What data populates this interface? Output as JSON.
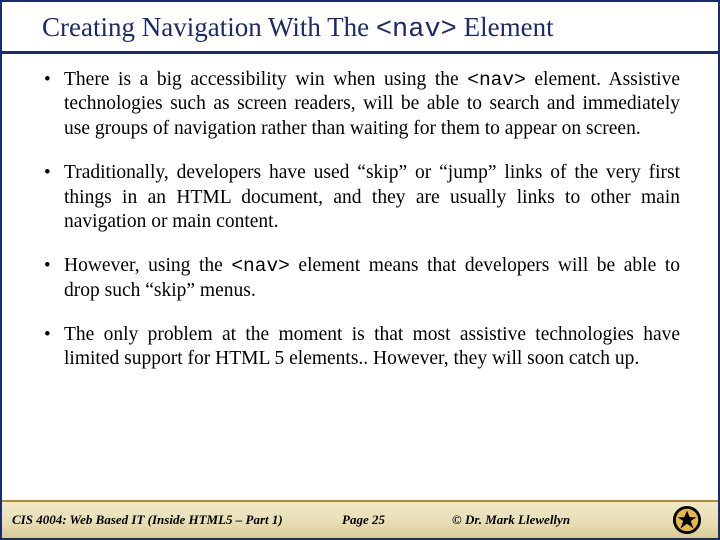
{
  "title": {
    "pre": "Creating Navigation With The ",
    "code": "<nav>",
    "post": " Element"
  },
  "bullets": [
    {
      "pre": "There is a big accessibility win when using the ",
      "code": "<nav>",
      "post": " element. Assistive technologies such as screen readers, will be able to search and immediately use groups of navigation rather than waiting for them to appear on screen."
    },
    {
      "pre": "Traditionally, developers have used “skip” or “jump” links of the very first things in an HTML document, and they are usually links to other main navigation or main content.",
      "code": "",
      "post": ""
    },
    {
      "pre": "However, using the ",
      "code": "<nav>",
      "post": " element means that developers will be able to drop such “skip” menus."
    },
    {
      "pre": "The only problem at the moment is that most assistive technologies have limited support for HTML 5 elements.. However, they will soon catch up.",
      "code": "",
      "post": ""
    }
  ],
  "footer": {
    "course": "CIS 4004: Web Based IT (Inside HTML5 – Part 1)",
    "page": "Page 25",
    "author": "© Dr. Mark Llewellyn"
  }
}
